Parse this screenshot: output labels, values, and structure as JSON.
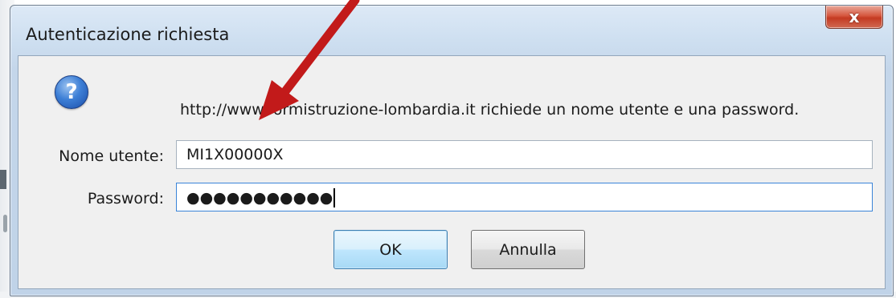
{
  "dialog": {
    "title": "Autenticazione richiesta",
    "close_symbol": "x",
    "icon": "question-icon",
    "message": "http://www.formistruzione-lombardia.it richiede un nome utente e una password.",
    "username_label": "Nome utente:",
    "username_value": "MI1X00000X",
    "password_label": "Password:",
    "password_mask": "●●●●●●●●●●●",
    "ok_label": "OK",
    "cancel_label": "Annulla"
  },
  "annotation": {
    "arrow_color": "#c21a1a"
  },
  "colors": {
    "title_gradient_top": "#dde9f6",
    "close_button": "#c43a22",
    "focus_border": "#3a84d8"
  }
}
